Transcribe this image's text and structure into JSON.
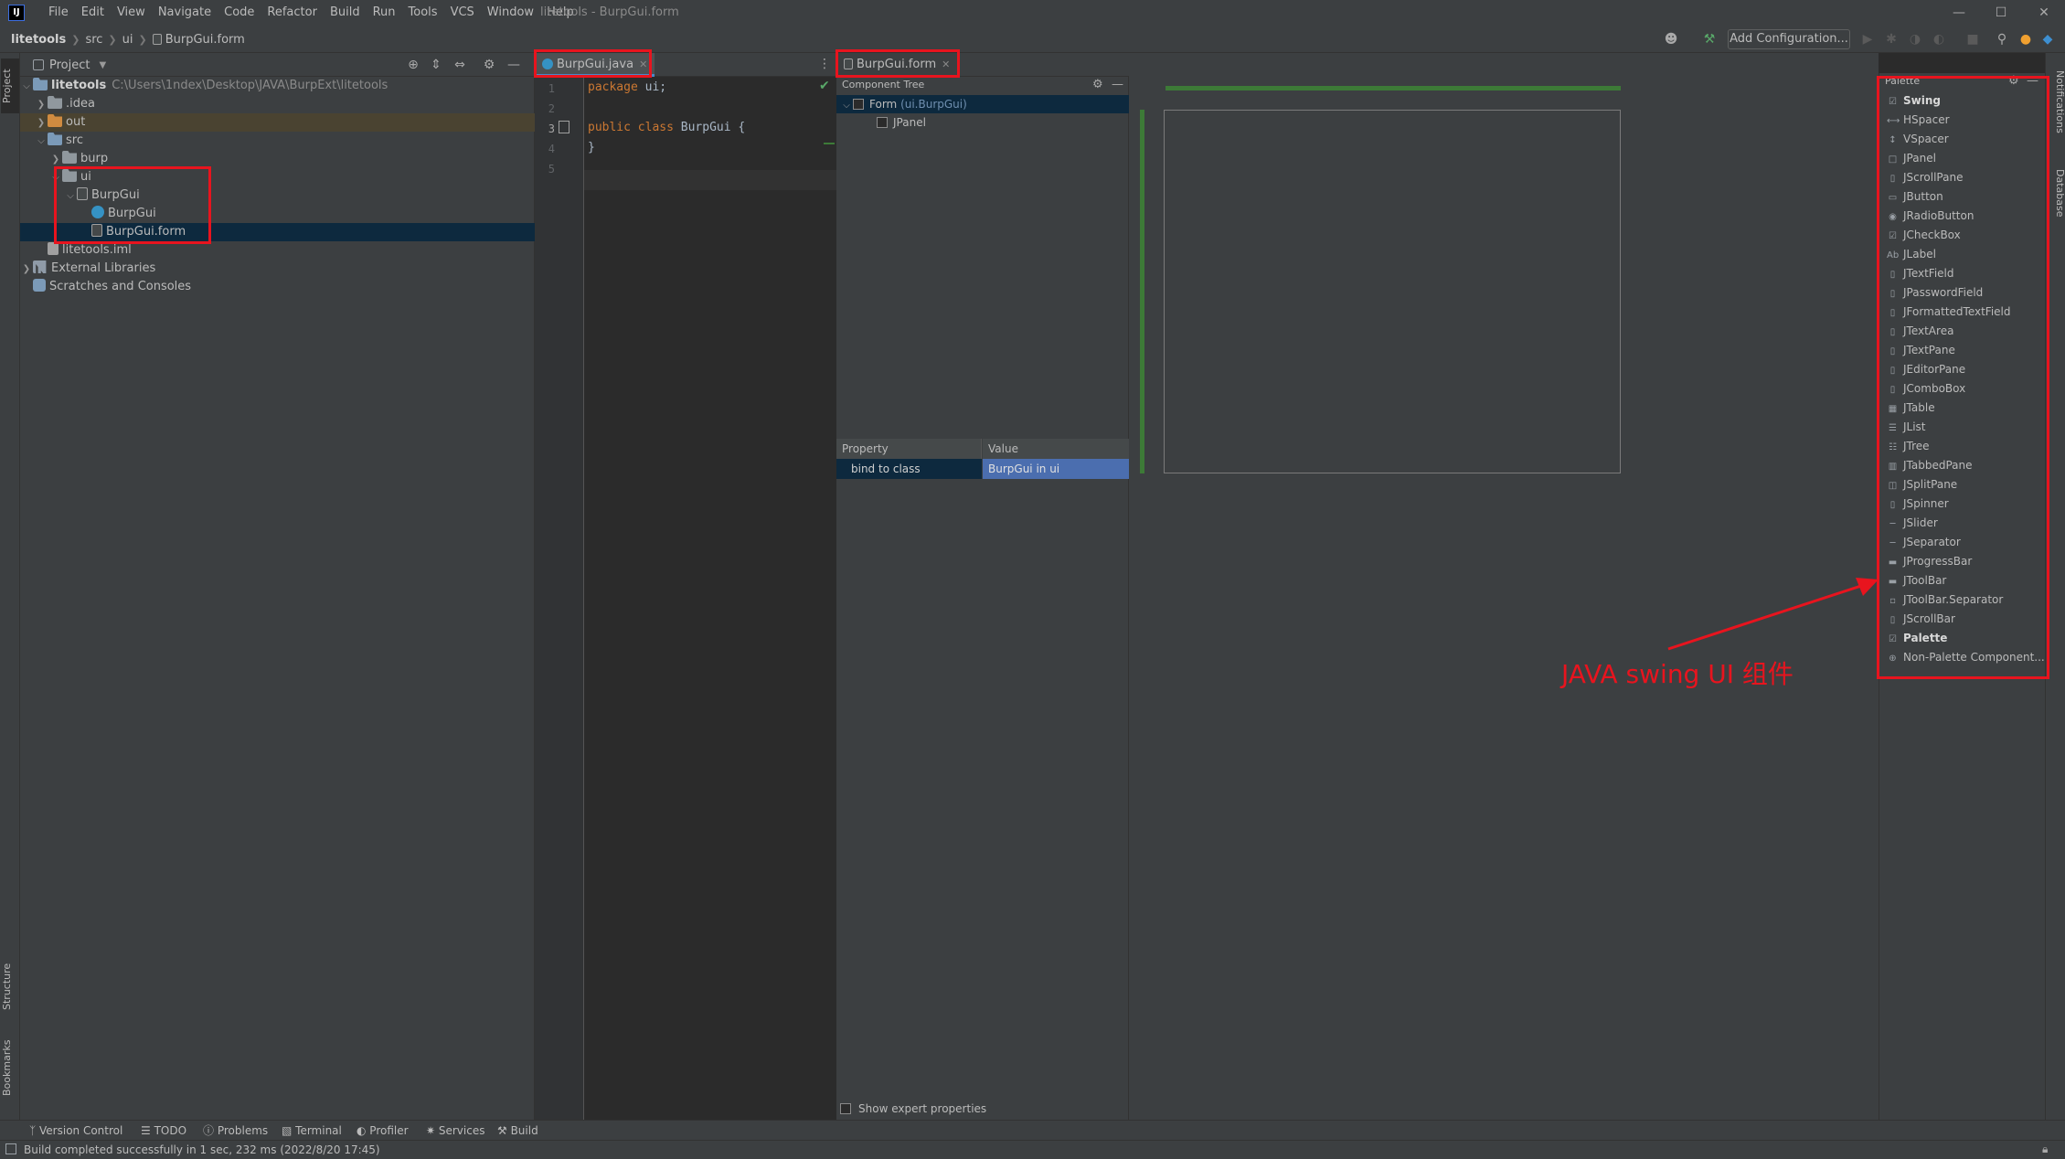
{
  "app": {
    "logo": "IJ",
    "window_title": "litetools - BurpGui.form",
    "menu": [
      "File",
      "Edit",
      "View",
      "Navigate",
      "Code",
      "Refactor",
      "Build",
      "Run",
      "Tools",
      "VCS",
      "Window",
      "Help"
    ]
  },
  "navbar": {
    "breadcrumb": [
      "litetools",
      "src",
      "ui",
      "BurpGui.form"
    ],
    "add_configuration": "Add Configuration..."
  },
  "left_stripe": {
    "project": "Project",
    "structure": "Structure",
    "bookmarks": "Bookmarks"
  },
  "right_stripe": {
    "notifications": "Notifications",
    "database": "Database"
  },
  "project_panel": {
    "title": "Project",
    "tree": [
      {
        "label": "litetools",
        "hint": "C:\\Users\\1ndex\\Desktop\\JAVA\\BurpExt\\litetools"
      },
      {
        "label": ".idea"
      },
      {
        "label": "out"
      },
      {
        "label": "src"
      },
      {
        "label": "burp"
      },
      {
        "label": "ui"
      },
      {
        "label": "BurpGui"
      },
      {
        "label": "BurpGui"
      },
      {
        "label": "BurpGui.form"
      },
      {
        "label": "litetools.iml"
      },
      {
        "label": "External Libraries"
      },
      {
        "label": "Scratches and Consoles"
      }
    ]
  },
  "editor": {
    "tab": "BurpGui.java",
    "line_numbers": [
      "1",
      "2",
      "3",
      "4",
      "5"
    ],
    "code": {
      "line1_kw": "package",
      "line1_rest": " ui;",
      "line3_kw1": "public",
      "line3_kw2": "class",
      "line3_cls": "BurpGui",
      "line3_rest": " {",
      "line4": "}"
    }
  },
  "form_editor": {
    "tab": "BurpGui.form",
    "component_tree_title": "Component Tree",
    "tree": [
      {
        "label": "Form",
        "hint": "(ui.BurpGui)"
      },
      {
        "label": "JPanel"
      }
    ],
    "properties": {
      "col_property": "Property",
      "col_value": "Value",
      "row_name": "bind to class",
      "row_value": "BurpGui in ui"
    },
    "show_expert": "Show expert properties"
  },
  "palette": {
    "title": "Palette",
    "items": [
      {
        "label": "Swing",
        "icon": "check",
        "group": true
      },
      {
        "label": "HSpacer",
        "icon": "hspacer"
      },
      {
        "label": "VSpacer",
        "icon": "vspacer"
      },
      {
        "label": "JPanel",
        "icon": "panel"
      },
      {
        "label": "JScrollPane",
        "icon": "scrollpane"
      },
      {
        "label": "JButton",
        "icon": "button"
      },
      {
        "label": "JRadioButton",
        "icon": "radio"
      },
      {
        "label": "JCheckBox",
        "icon": "checkbox"
      },
      {
        "label": "JLabel",
        "icon": "label"
      },
      {
        "label": "JTextField",
        "icon": "textfield"
      },
      {
        "label": "JPasswordField",
        "icon": "password"
      },
      {
        "label": "JFormattedTextField",
        "icon": "formatted"
      },
      {
        "label": "JTextArea",
        "icon": "textarea"
      },
      {
        "label": "JTextPane",
        "icon": "textpane"
      },
      {
        "label": "JEditorPane",
        "icon": "editorpane"
      },
      {
        "label": "JComboBox",
        "icon": "combobox"
      },
      {
        "label": "JTable",
        "icon": "table"
      },
      {
        "label": "JList",
        "icon": "list"
      },
      {
        "label": "JTree",
        "icon": "tree"
      },
      {
        "label": "JTabbedPane",
        "icon": "tabbed"
      },
      {
        "label": "JSplitPane",
        "icon": "split"
      },
      {
        "label": "JSpinner",
        "icon": "spinner"
      },
      {
        "label": "JSlider",
        "icon": "slider"
      },
      {
        "label": "JSeparator",
        "icon": "separator"
      },
      {
        "label": "JProgressBar",
        "icon": "progress"
      },
      {
        "label": "JToolBar",
        "icon": "toolbar"
      },
      {
        "label": "JToolBar.Separator",
        "icon": "toolbar-separator"
      },
      {
        "label": "JScrollBar",
        "icon": "scrollbar"
      },
      {
        "label": "Palette",
        "icon": "check",
        "group": true
      },
      {
        "label": "Non-Palette Component...",
        "icon": "globe"
      }
    ]
  },
  "annotation": {
    "text": "JAVA swing UI 组件",
    "color": "#e8141e"
  },
  "bottom_tools": [
    "Version Control",
    "TODO",
    "Problems",
    "Terminal",
    "Profiler",
    "Services",
    "Build"
  ],
  "status": {
    "message": "Build completed successfully in 1 sec, 232 ms (2022/8/20 17:45)"
  },
  "colors": {
    "background": "#2b2b2b",
    "panel": "#3c3f41",
    "selection": "#0d293e",
    "accent": "#4a88c7",
    "design_guide": "#3d7a37"
  }
}
